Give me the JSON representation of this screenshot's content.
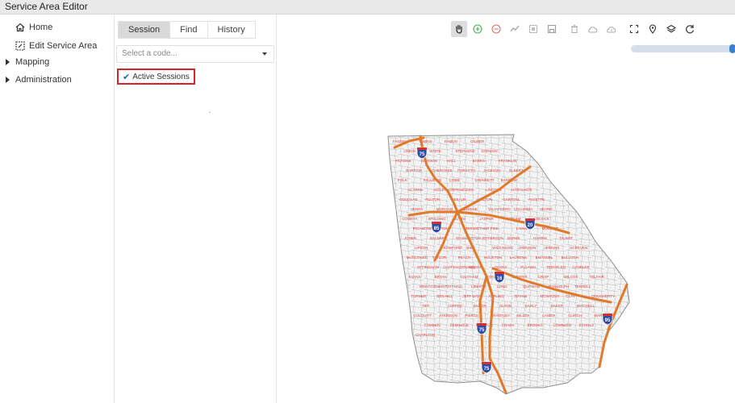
{
  "app": {
    "title": "Service Area Editor"
  },
  "nav": {
    "home": "Home",
    "edit_service_area": "Edit Service Area",
    "mapping": "Mapping",
    "administration": "Administration"
  },
  "panel": {
    "tabs": [
      "Session",
      "Find",
      "History"
    ],
    "active_tab": "Session",
    "code_select": {
      "placeholder": "Select a code..."
    },
    "active_sessions_label": "Active Sessions"
  },
  "toolbar": {
    "tools": [
      "pan-hand-icon",
      "add-icon",
      "remove-icon",
      "draw-line-icon",
      "select-area-icon",
      "save-icon",
      "delete-icon",
      "cloud-upload-icon",
      "cloud-download-icon",
      "fullscreen-icon",
      "location-pin-icon",
      "layers-icon",
      "refresh-icon"
    ],
    "selected_tool": "pan-hand-icon"
  },
  "map": {
    "interstate_shields": [
      "75",
      "85",
      "20",
      "16",
      "95",
      "75",
      "75"
    ],
    "county_labels": [
      "FANNIN",
      "TOWNS",
      "RABUN",
      "GILMER",
      "UNION",
      "WHITE",
      "STEPHENS",
      "GORDON",
      "PICKENS",
      "DAWSON",
      "HALL",
      "BANKS",
      "FRANKLIN",
      "BARTOW",
      "CHEROKEE",
      "FORSYTH",
      "JACKSON",
      "ELBERT",
      "POLK",
      "PAULDING",
      "COBB",
      "GWINNETT",
      "BARROW",
      "CLARKE",
      "OGLETHORPE",
      "WILKES",
      "LINCOLN",
      "HARALSON",
      "DOUGLAS",
      "FULTON",
      "DEKALB",
      "WALTON",
      "CARROLL",
      "FAYETTE",
      "HENRY",
      "MORGAN",
      "GREENE",
      "TALIAFERRO",
      "COLUMBIA",
      "HEARD",
      "COWETA",
      "SPALDING",
      "BUTTS",
      "JASPER",
      "PUTNAM",
      "HANCOCK",
      "RICHMOND",
      "TROUP",
      "MERIWETHER",
      "PIKE",
      "LAMAR",
      "MONROE",
      "JONES",
      "BALDWIN",
      "WASHINGTON",
      "JEFFERSON",
      "BURKE",
      "HARRIS",
      "TALBOT",
      "UPSON",
      "CRAWFORD",
      "BIBB",
      "WILKINSON",
      "JOHNSON",
      "JENKINS",
      "SCREVEN",
      "MUSCOGEE",
      "TAYLOR",
      "PEACH",
      "HOUSTON",
      "LAURENS",
      "EMANUEL",
      "BULLOCH",
      "EFFINGHAM",
      "CHATTAHOOCHEE",
      "MACON",
      "DOOLY",
      "PULASKI",
      "TREUTLEN",
      "CANDLER",
      "EVANS",
      "BRYAN",
      "CHATHAM",
      "STEWART",
      "SUMTER",
      "CRISP",
      "WILCOX",
      "TELFAIR",
      "MONTGOMERY",
      "TATTNALL",
      "LIBERTY",
      "LONG",
      "QUITMAN",
      "RANDOLPH",
      "TERRELL",
      "TURNER",
      "BEN HILL",
      "JEFF DAVIS",
      "APPLING",
      "WAYNE",
      "MCINTOSH",
      "CLAY",
      "DOUGHERTY",
      "TIFT",
      "COFFEE",
      "BACON",
      "GLYNN",
      "EARLY",
      "BAKER",
      "MITCHELL",
      "COLQUITT",
      "ATKINSON",
      "PIERCE",
      "BRANTLEY",
      "MILLER",
      "LANIER",
      "CLINCH",
      "WARE",
      "CAMDEN",
      "SEMINOLE",
      "DECATUR",
      "GRADY",
      "BROOKS",
      "LOWNDES",
      "ECHOLS",
      "CHARLTON"
    ]
  }
}
